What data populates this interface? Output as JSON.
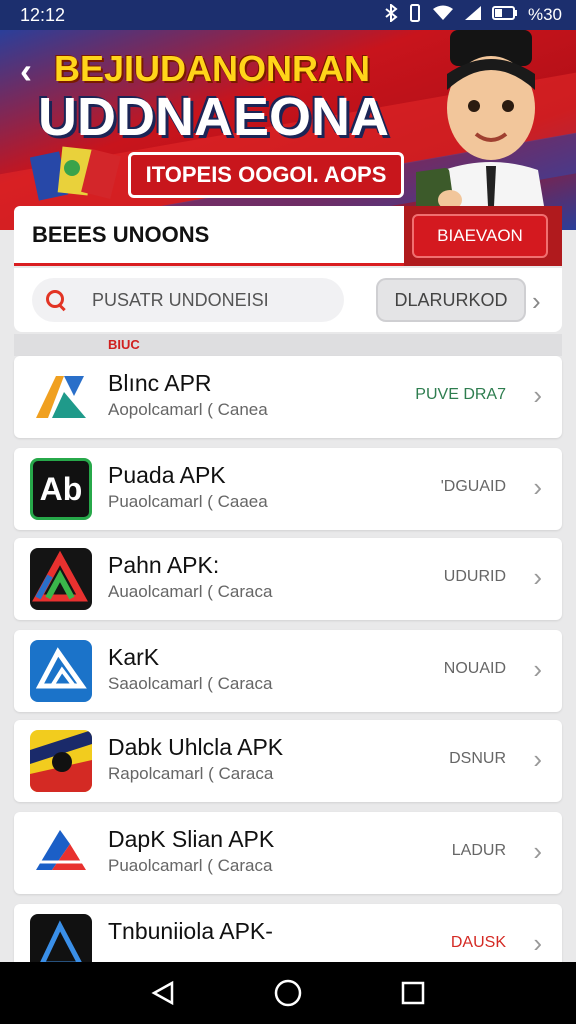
{
  "status_bar": {
    "time": "12:12",
    "battery": "%30"
  },
  "banner": {
    "title_line1": "BEJIUDANONRAN",
    "title_line2": "UDDNAEONA",
    "promo": "ITOPEIS OOGOI. AOPS"
  },
  "section": {
    "title": "BEEES UNOONS",
    "button_label": "BIAEVAON"
  },
  "search": {
    "placeholder": "PUSATR UNDONEISI",
    "download_label": "DLARURKOD"
  },
  "list_subtitle": "BIUC",
  "apps": [
    {
      "name": "Blınc APR",
      "sub": "Aopolcamarl ( Canea",
      "action": "PUVE DRA7",
      "action_color": "#2e7d4f"
    },
    {
      "name": "Puada APK",
      "sub": "Puaolcamarl ( Caaea",
      "action": "'DGUAID",
      "action_color": "#666666"
    },
    {
      "name": "Pahn APK:",
      "sub": "Auaolcamarl ( Caraca",
      "action": "UDURID",
      "action_color": "#666666"
    },
    {
      "name": "KarK",
      "sub": "Saaolcamarl ( Caraca",
      "action": "NOUAID",
      "action_color": "#666666"
    },
    {
      "name": "Dabk Uhlcla APK",
      "sub": "Rapolcamarl ( Caraca",
      "action": "DSNUR",
      "action_color": "#666666"
    },
    {
      "name": "DapK Slian APK",
      "sub": "Puaolcamarl ( Caraca",
      "action": "LADUR",
      "action_color": "#666666"
    },
    {
      "name": "Tnbuniiola APK-",
      "sub": "",
      "action": "DAUSK",
      "action_color": "#d42a24"
    }
  ],
  "icons": {
    "back": "chevron-left-icon",
    "search": "search-icon",
    "chevron": "chevron-right-icon",
    "nav": [
      "back-triangle-icon",
      "home-circle-icon",
      "recents-square-icon"
    ]
  },
  "colors": {
    "brand_red": "#d4191f",
    "brand_blue": "#2a3f9a",
    "banner_yellow": "#ffd51a"
  }
}
